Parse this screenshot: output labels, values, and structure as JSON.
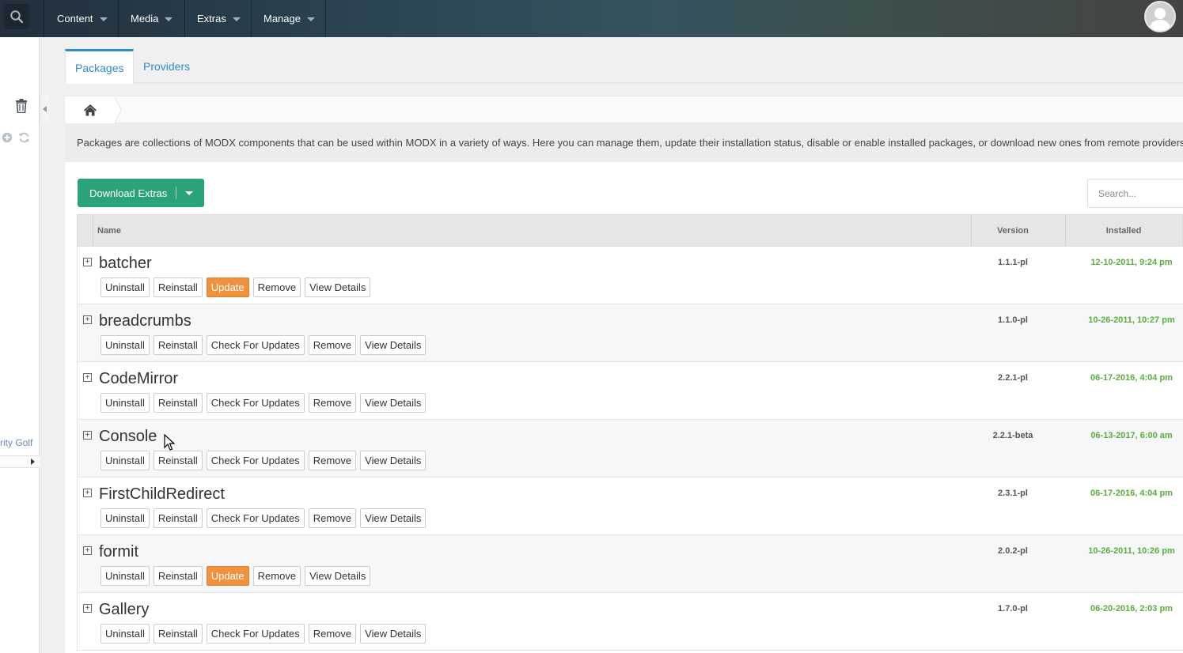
{
  "topbar": {
    "menus": [
      {
        "label": "Content"
      },
      {
        "label": "Media"
      },
      {
        "label": "Extras"
      },
      {
        "label": "Manage"
      }
    ]
  },
  "tree": {
    "partial_label": "rity Golf"
  },
  "tabs": [
    {
      "label": "Packages",
      "active": true
    },
    {
      "label": "Providers",
      "active": false
    }
  ],
  "description": "Packages are collections of MODX components that can be used within MODX in a variety of ways. Here you can manage them, update their installation status, disable or enable installed packages, or download new ones from remote providers",
  "toolbar": {
    "download_label": "Download Extras",
    "search_placeholder": "Search..."
  },
  "grid": {
    "columns": {
      "name": "Name",
      "version": "Version",
      "installed": "Installed"
    },
    "packages": [
      {
        "name": "batcher",
        "version": "1.1.1-pl",
        "installed": "12-10-2011, 9:24 pm",
        "actions": [
          "Uninstall",
          "Reinstall",
          "Update",
          "Remove",
          "View Details"
        ]
      },
      {
        "name": "breadcrumbs",
        "version": "1.1.0-pl",
        "installed": "10-26-2011, 10:27 pm",
        "actions": [
          "Uninstall",
          "Reinstall",
          "Check For Updates",
          "Remove",
          "View Details"
        ]
      },
      {
        "name": "CodeMirror",
        "version": "2.2.1-pl",
        "installed": "06-17-2016, 4:04 pm",
        "actions": [
          "Uninstall",
          "Reinstall",
          "Check For Updates",
          "Remove",
          "View Details"
        ]
      },
      {
        "name": "Console",
        "version": "2.2.1-beta",
        "installed": "06-13-2017, 6:00 am",
        "actions": [
          "Uninstall",
          "Reinstall",
          "Check For Updates",
          "Remove",
          "View Details"
        ]
      },
      {
        "name": "FirstChildRedirect",
        "version": "2.3.1-pl",
        "installed": "06-17-2016, 4:04 pm",
        "actions": [
          "Uninstall",
          "Reinstall",
          "Check For Updates",
          "Remove",
          "View Details"
        ]
      },
      {
        "name": "formit",
        "version": "2.0.2-pl",
        "installed": "10-26-2011, 10:26 pm",
        "actions": [
          "Uninstall",
          "Reinstall",
          "Update",
          "Remove",
          "View Details"
        ]
      },
      {
        "name": "Gallery",
        "version": "1.7.0-pl",
        "installed": "06-20-2016, 2:03 pm",
        "actions": [
          "Uninstall",
          "Reinstall",
          "Check For Updates",
          "Remove",
          "View Details"
        ]
      }
    ]
  },
  "colors": {
    "accent": "#2f8bc9",
    "download_button": "#2aa37c",
    "update_button": "#f0913e",
    "installed_date": "#5aac3c"
  }
}
